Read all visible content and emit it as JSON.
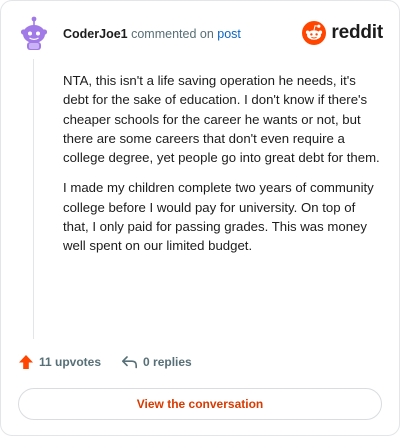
{
  "header": {
    "username": "CoderJoe1",
    "action_text": "commented on",
    "post_link_text": "post",
    "brand_name": "reddit"
  },
  "comment": {
    "paragraphs": [
      "NTA, this isn't a life saving operation he needs, it's debt for the sake of education. I don't know if there's cheaper schools for the career he wants or not, but there are some careers that don't even require a college degree, yet people go into great debt for them.",
      "I made my children complete two years of community college before I would pay for university. On top of that, I only paid for passing grades. This was money well spent on our limited budget."
    ]
  },
  "stats": {
    "upvotes_label": "11 upvotes",
    "replies_label": "0 replies"
  },
  "cta": {
    "label": "View the conversation"
  },
  "colors": {
    "accent": "#d93a00",
    "brand_orange": "#ff4500",
    "link_blue": "#0a66c2",
    "muted_text": "#576f76",
    "avatar_purple": "#a17ae8"
  },
  "icons": {
    "avatar": "snoo-avatar-icon",
    "brand": "reddit-logo-icon",
    "upvote": "upvote-arrow-icon",
    "reply": "reply-arrow-icon"
  }
}
